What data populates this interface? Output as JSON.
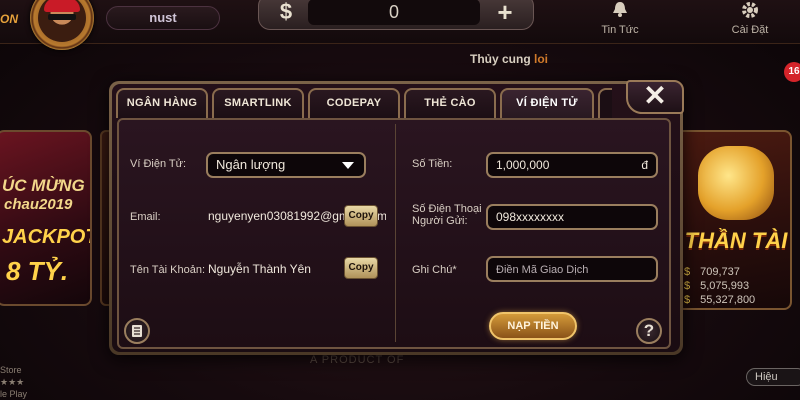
{
  "topbar": {
    "username": "nust",
    "balance": "0",
    "currency_symbol": "$",
    "plus_symbol": "+",
    "news_label": "Tin Tức",
    "settings_label": "Cài Đặt"
  },
  "marquee": {
    "text": "Thủy cung ",
    "highlight": "loi"
  },
  "notification_badge": "16",
  "left_card": {
    "line1": "ÚC MỪNG",
    "line2": "chau2019",
    "line3": "JACKPOT",
    "line4": "8 TỶ."
  },
  "right_card": {
    "title": "THẦN TÀI",
    "jackpots": [
      {
        "symbol": "$",
        "value": "709,737"
      },
      {
        "symbol": "$",
        "value": "5,075,993"
      },
      {
        "symbol": "$",
        "value": "55,327,800"
      }
    ]
  },
  "bottom": {
    "store_label": "Store",
    "stars": "★★★",
    "play_label": "le Play",
    "product_text": "A PRODUCT OF",
    "hieu_label": "Hiệu"
  },
  "modal": {
    "tabs": [
      "NGÂN HÀNG",
      "SMARTLINK",
      "CODEPAY",
      "THẺ CÀO",
      "VÍ ĐIỆN TỬ"
    ],
    "active_tab": "VÍ ĐIỆN TỬ",
    "close_symbol": "✕",
    "left": {
      "wallet_label": "Ví Điện Tử:",
      "wallet_value": "Ngân lượng",
      "email_label": "Email:",
      "email_value": "nguyenyen03081992@gmail.com",
      "account_label": "Tên Tài Khoản:",
      "account_value": "Nguyễn Thành Yên",
      "copy_label": "Copy"
    },
    "right": {
      "amount_label": "Số Tiền:",
      "amount_value": "1,000,000",
      "amount_currency": "đ",
      "phone_label_1": "Số Điện Thoại",
      "phone_label_2": "Người Gửi:",
      "phone_value": "098xxxxxxxx",
      "note_label": "Ghi Chú*",
      "note_placeholder": "Điền Mã Giao Dịch"
    },
    "submit_label": "NẠP TIỀN",
    "help_symbol": "?"
  }
}
